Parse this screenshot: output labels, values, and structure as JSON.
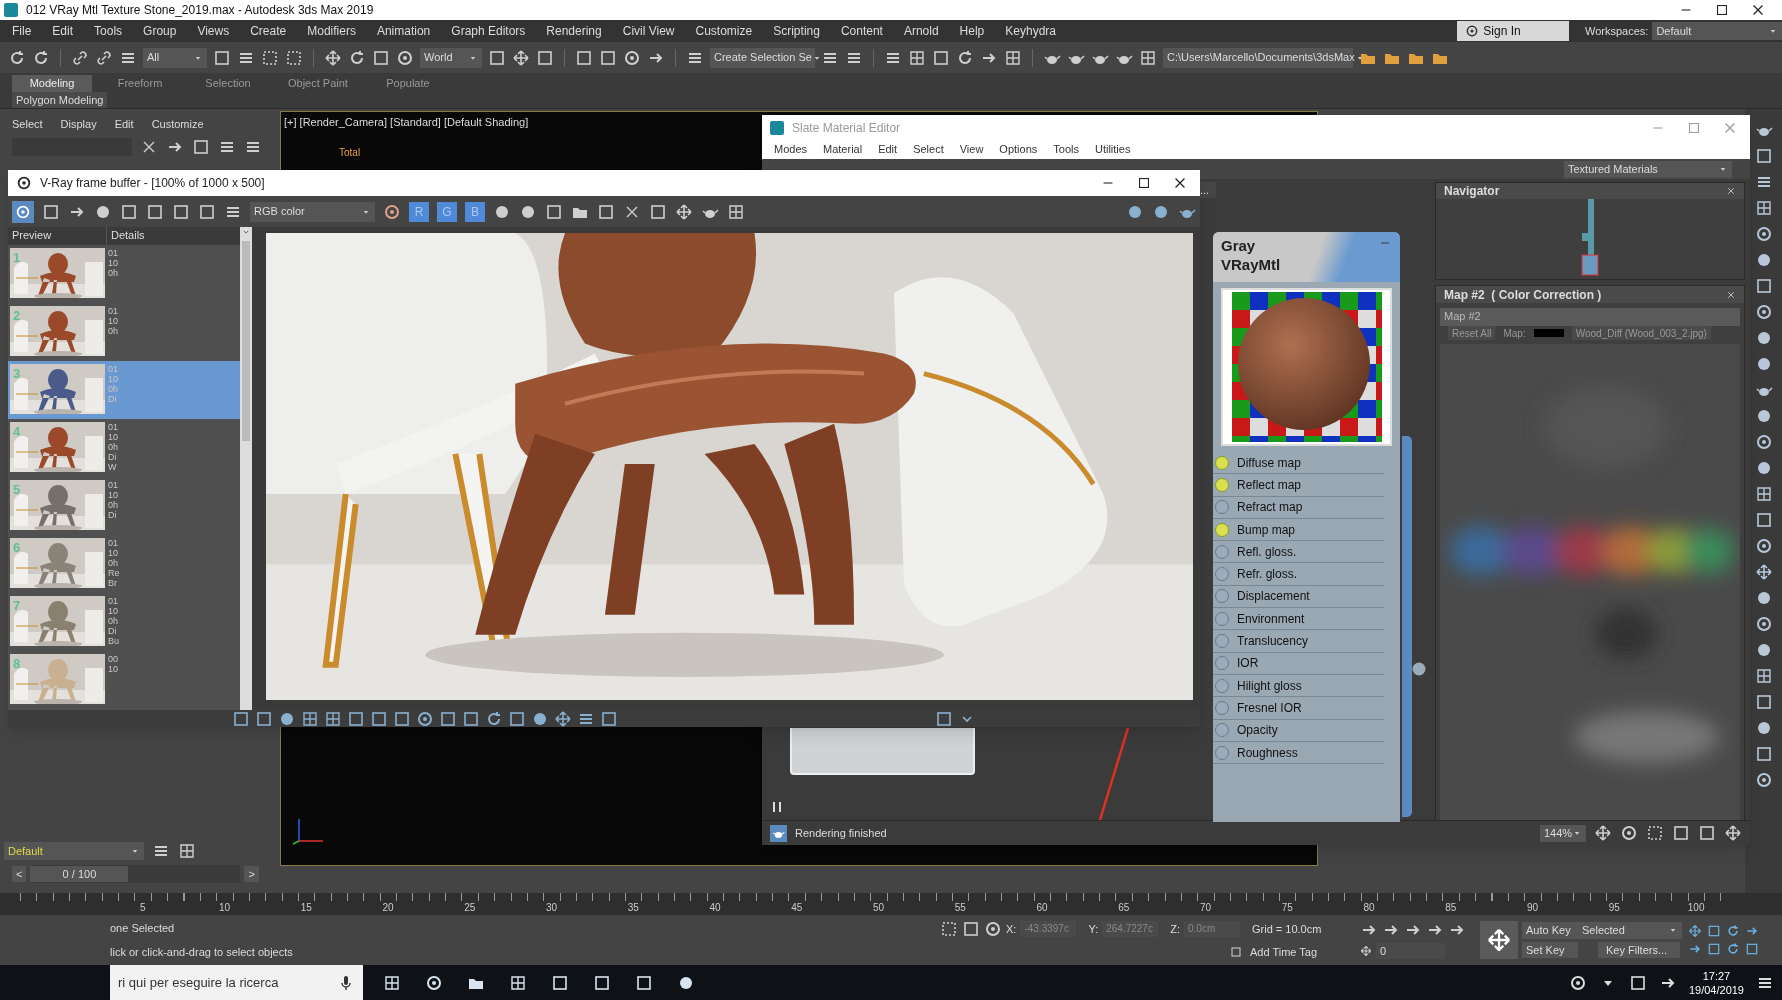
{
  "window": {
    "title": "012 VRay Mtl Texture Stone_2019.max - Autodesk 3ds Max 2019"
  },
  "menu": [
    "File",
    "Edit",
    "Tools",
    "Group",
    "Views",
    "Create",
    "Modifiers",
    "Animation",
    "Graph Editors",
    "Rendering",
    "Civil View",
    "Customize",
    "Scripting",
    "Content",
    "Arnold",
    "Help",
    "Keyhydra"
  ],
  "account": {
    "sign_in": "Sign In",
    "workspaces_label": "Workspaces:",
    "workspace": "Default"
  },
  "toolbar": {
    "selection_filter": "All",
    "reference_coord": "World",
    "named_selection": "Create Selection Se",
    "project_path": "C:\\Users\\Marcello\\Documents\\3dsMax"
  },
  "ribbon": {
    "tabs": [
      {
        "label": "Modeling",
        "selected": true
      },
      {
        "label": "Freeform",
        "selected": false
      },
      {
        "label": "Selection",
        "selected": false
      },
      {
        "label": "Object Paint",
        "selected": false
      },
      {
        "label": "Populate",
        "selected": false
      }
    ],
    "panel": "Polygon Modeling"
  },
  "command_panel": {
    "menu": [
      "Select",
      "Display",
      "Edit",
      "Customize"
    ]
  },
  "viewport": {
    "label": "[+] [Render_Camera] [Standard] [Default Shading]",
    "stat": "Total"
  },
  "slate_editor": {
    "title": "Slate Material Editor",
    "menu": [
      "Modes",
      "Material",
      "Edit",
      "Select",
      "View",
      "Options",
      "Tools",
      "Utilities"
    ],
    "view_dropdown": "Textured Materials",
    "tab": "...",
    "node": {
      "title": "Gray",
      "type": "VRayMtl",
      "slots": [
        {
          "label": "Diffuse map",
          "connected": true
        },
        {
          "label": "Reflect map",
          "connected": true
        },
        {
          "label": "Refract map",
          "connected": false
        },
        {
          "label": "Bump map",
          "connected": true
        },
        {
          "label": "Refl. gloss.",
          "connected": false
        },
        {
          "label": "Refr. gloss.",
          "connected": false
        },
        {
          "label": "Displacement",
          "connected": false
        },
        {
          "label": "Environment",
          "connected": false
        },
        {
          "label": "Translucency",
          "connected": false
        },
        {
          "label": "IOR",
          "connected": false
        },
        {
          "label": "Hilight gloss",
          "connected": false
        },
        {
          "label": "Fresnel IOR",
          "connected": false
        },
        {
          "label": "Opacity",
          "connected": false
        },
        {
          "label": "Roughness",
          "connected": false
        }
      ]
    },
    "navigator": {
      "title": "Navigator"
    },
    "parameters": {
      "title": "Map #2  ( Color Correction )",
      "name": "Map #2",
      "reset": "Reset All",
      "map_label": "Map:",
      "map_file": "Wood_Diff (Wood_003_2.jpg)"
    },
    "status": "Rendering finished",
    "zoom": "144%"
  },
  "frame_buffer": {
    "title": "V-Ray frame buffer - [100% of 1000 x 500]",
    "channel": "RGB color",
    "channel_buttons": [
      {
        "label": "R",
        "on": true
      },
      {
        "label": "G",
        "on": true
      },
      {
        "label": "B",
        "on": true
      }
    ],
    "history_columns": [
      "Preview",
      "Details"
    ],
    "history": [
      {
        "number": "1",
        "details": [
          "01",
          "10",
          "0h"
        ],
        "selected": false
      },
      {
        "number": "2",
        "details": [
          "01",
          "10",
          "0h"
        ],
        "selected": false
      },
      {
        "number": "3",
        "details": [
          "01",
          "10",
          "0h",
          "Di"
        ],
        "selected": true
      },
      {
        "number": "4",
        "details": [
          "01",
          "10",
          "0h",
          "Di",
          "W"
        ],
        "selected": false
      },
      {
        "number": "5",
        "details": [
          "01",
          "10",
          "0h",
          "Di"
        ],
        "selected": false
      },
      {
        "number": "6",
        "details": [
          "01",
          "10",
          "0h",
          "Re",
          "Br"
        ],
        "selected": false
      },
      {
        "number": "7",
        "details": [
          "01",
          "10",
          "0h",
          "Di",
          "Bu"
        ],
        "selected": false
      },
      {
        "number": "8",
        "details": [
          "00",
          "10"
        ],
        "selected": false
      }
    ]
  },
  "layers": {
    "layer": "Default"
  },
  "time_slider": {
    "prev": "<",
    "label": "0 / 100",
    "next": ">",
    "level": 0
  },
  "timeline": {
    "ticks": [
      "5",
      "10",
      "15",
      "20",
      "25",
      "30",
      "35",
      "40",
      "45",
      "50",
      "55",
      "60",
      "65",
      "70",
      "75",
      "80",
      "85",
      "90",
      "95",
      "100"
    ]
  },
  "status_bar": {
    "selection": "one Selected",
    "prompt": "lick or click-and-drag to select objects",
    "x_label": "X:",
    "x": "-43.3397c",
    "y_label": "Y:",
    "y": "264.7227c",
    "z_label": "Z:",
    "z": "0.0cm",
    "grid": "Grid = 10.0cm",
    "time_tag": "Add Time Tag",
    "auto_key": "Auto Key",
    "key_mode": "Selected",
    "set_key": "Set Key",
    "key_filters": "Key Filters...",
    "frame": "0"
  },
  "taskbar": {
    "search": "ri qui per eseguire la ricerca",
    "time": "17:27",
    "date": "19/04/2019"
  }
}
